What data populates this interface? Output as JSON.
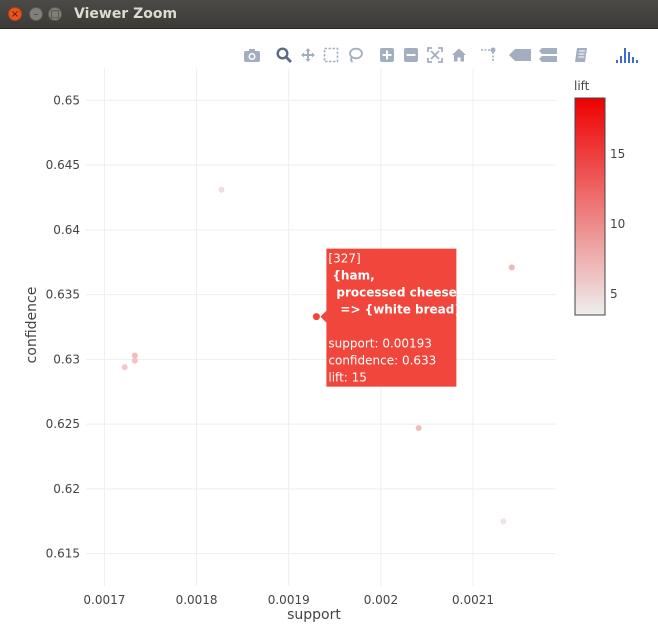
{
  "window": {
    "title": "Viewer Zoom",
    "close_glyph": "×",
    "minimize_glyph": "–",
    "maximize_glyph": "□"
  },
  "modebar": {
    "icons": [
      "camera-icon",
      "zoom-icon",
      "pan-icon",
      "box-select-icon",
      "lasso-select-icon",
      "zoom-in-icon",
      "zoom-out-icon",
      "autoscale-icon",
      "reset-axes-icon",
      "spike-lines-icon",
      "hover-closest-icon",
      "hover-compare-icon",
      "edit-chart-icon",
      "plotly-logo-icon"
    ],
    "colors": {
      "icon": "#a3aec0",
      "active": "#5b6a85",
      "logo": "#3f6bd4"
    }
  },
  "chart_data": {
    "type": "scatter",
    "xlabel": "support",
    "ylabel": "confidence",
    "xlim": [
      0.00168,
      0.00219
    ],
    "ylim": [
      0.6125,
      0.6525
    ],
    "xticks": [
      0.0017,
      0.0018,
      0.0019,
      0.002,
      0.0021
    ],
    "xtick_labels": [
      "0.0017",
      "0.0018",
      "0.0019",
      "0.002",
      "0.0021"
    ],
    "yticks": [
      0.615,
      0.62,
      0.625,
      0.63,
      0.635,
      0.64,
      0.645,
      0.65
    ],
    "ytick_labels": [
      "0.615",
      "0.62",
      "0.625",
      "0.63",
      "0.635",
      "0.64",
      "0.645",
      "0.65"
    ],
    "grid": true,
    "points": [
      {
        "x": 0.001722,
        "y": 0.6294,
        "lift": 6.5
      },
      {
        "x": 0.001733,
        "y": 0.6303,
        "lift": 7.5
      },
      {
        "x": 0.001733,
        "y": 0.6299,
        "lift": 7.0
      },
      {
        "x": 0.001827,
        "y": 0.6431,
        "lift": 5.0
      },
      {
        "x": 0.00193,
        "y": 0.6333,
        "lift": 15.0
      },
      {
        "x": 0.002041,
        "y": 0.6247,
        "lift": 7.5
      },
      {
        "x": 0.002133,
        "y": 0.6175,
        "lift": 4.5
      },
      {
        "x": 0.002142,
        "y": 0.6371,
        "lift": 8.0
      }
    ],
    "hover": {
      "point_index": 4,
      "lines": [
        "[327]",
        "{ham,",
        "processed cheese}",
        "=> {white bread}",
        "",
        "support: 0.00193",
        "confidence: 0.633",
        "lift: 15"
      ],
      "bold_lines": [
        1,
        2,
        3
      ]
    },
    "colorbar": {
      "title": "lift",
      "range": [
        3.5,
        19
      ],
      "ticks": [
        5,
        10,
        15
      ],
      "tick_labels": [
        "5",
        "10",
        "15"
      ],
      "color_low": "#eeeeee",
      "color_high": "#ee0000"
    },
    "hover_color": "#f0463c"
  }
}
